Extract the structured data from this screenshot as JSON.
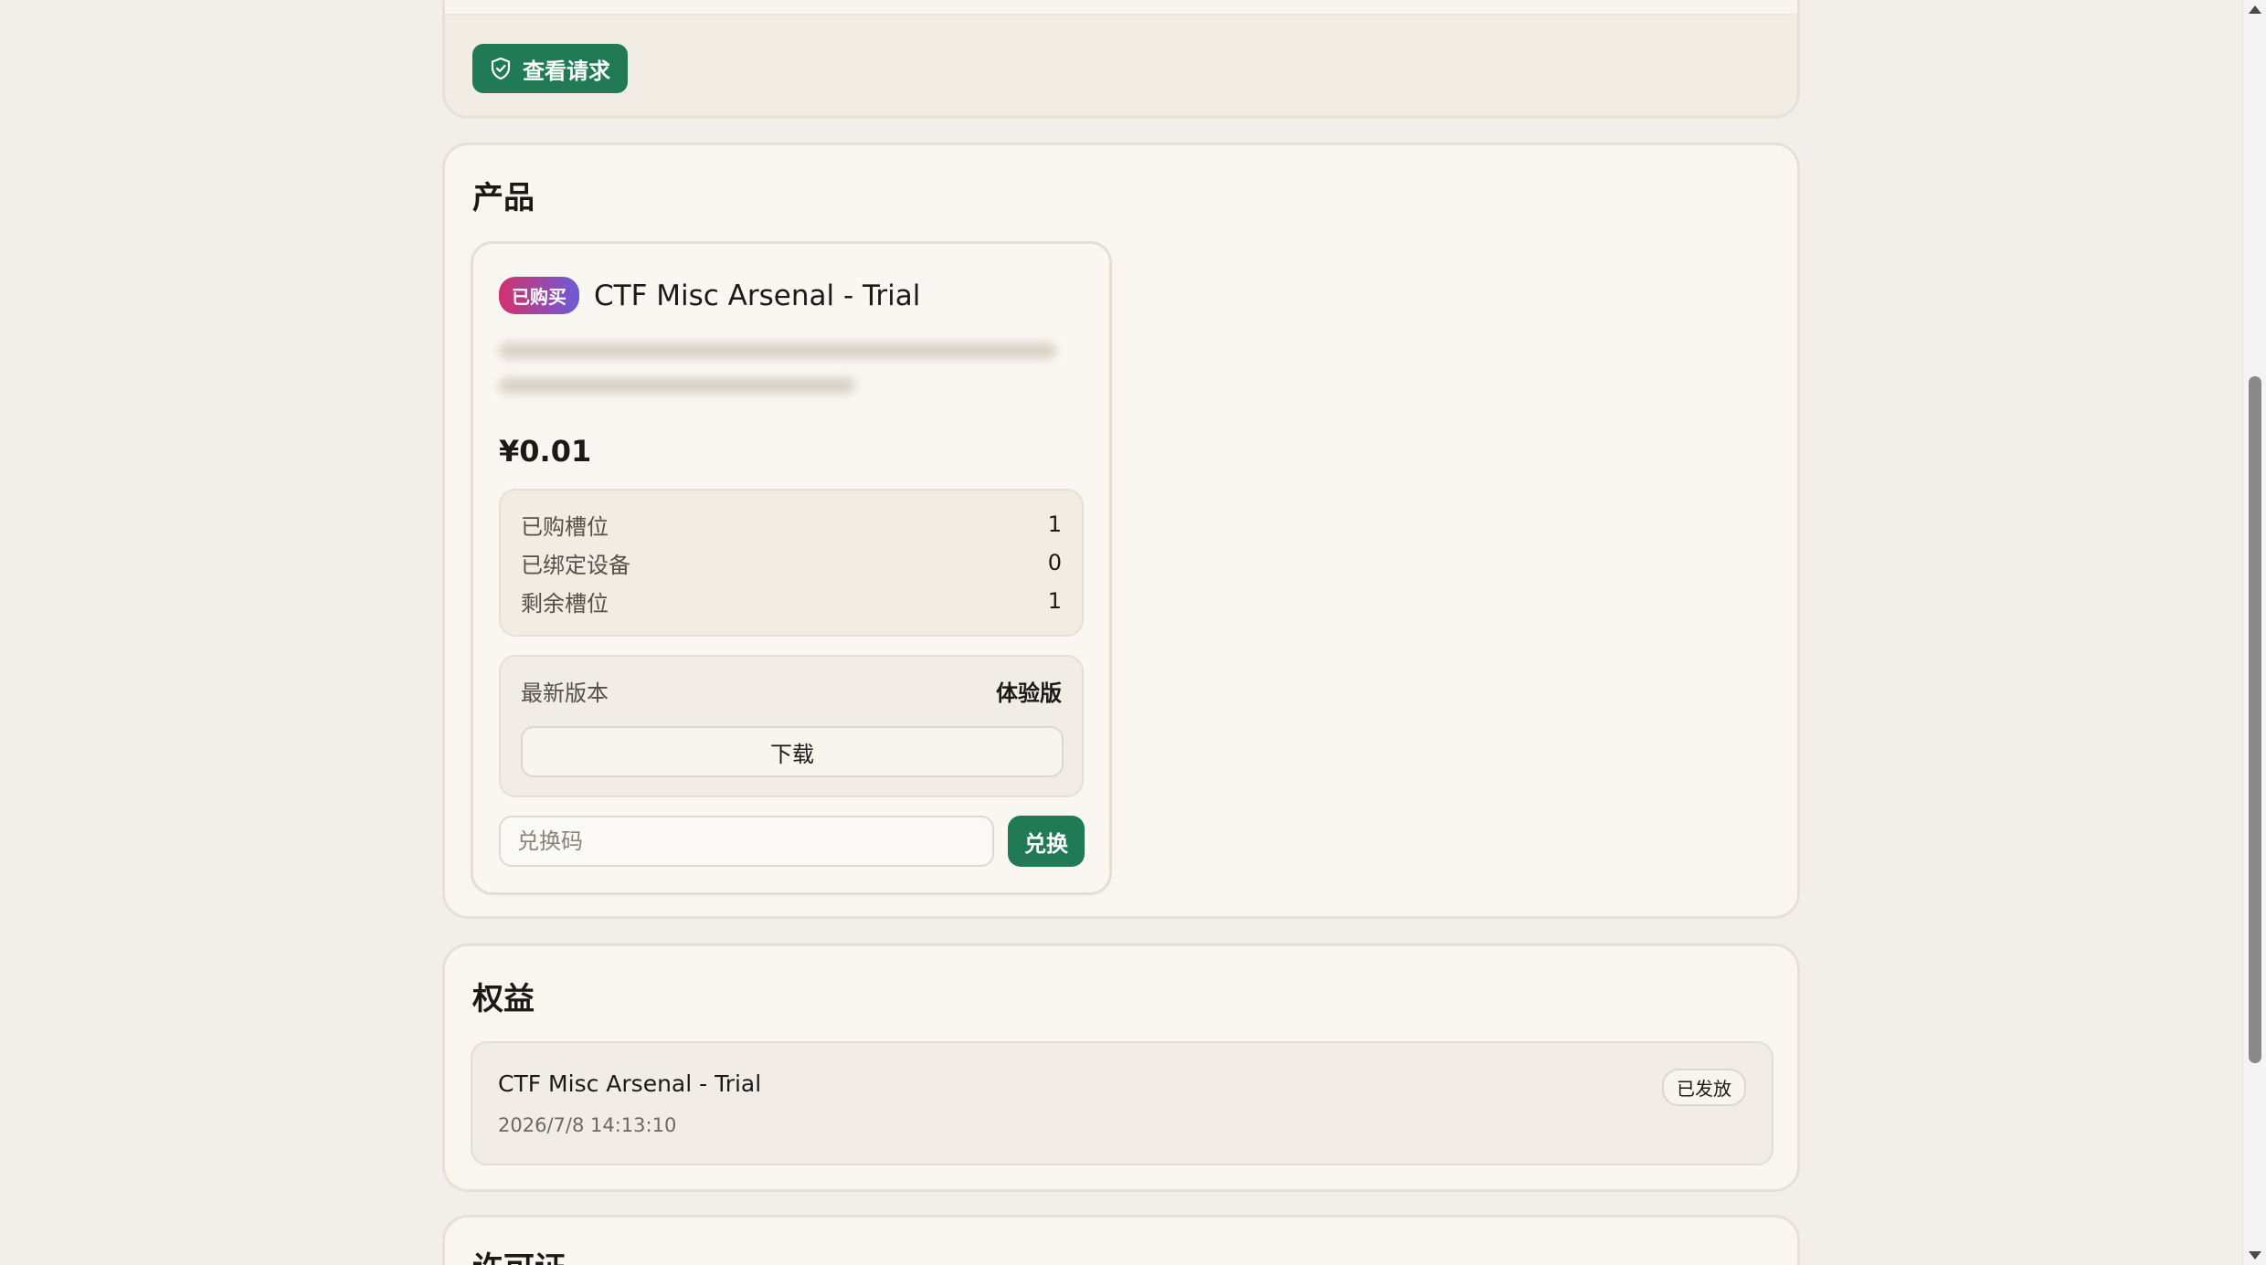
{
  "top_card": {
    "view_request_label": "查看请求"
  },
  "products": {
    "section_title": "产品",
    "item": {
      "badge": "已购买",
      "name": "CTF Misc Arsenal - Trial",
      "price": "¥0.01",
      "stats": [
        {
          "label": "已购槽位",
          "value": "1"
        },
        {
          "label": "已绑定设备",
          "value": "0"
        },
        {
          "label": "剩余槽位",
          "value": "1"
        }
      ],
      "latest_version_label": "最新版本",
      "latest_version_value": "体验版",
      "download_label": "下载",
      "redeem_placeholder": "兑换码",
      "redeem_button": "兑换"
    }
  },
  "rights": {
    "section_title": "权益",
    "item": {
      "name": "CTF Misc Arsenal - Trial",
      "status": "已发放",
      "time": "2026/7/8 14:13:10"
    }
  },
  "license": {
    "section_title": "许可证"
  },
  "colors": {
    "accent_green": "#1f7a55",
    "page_bg": "#f2efea",
    "card_bg": "#f9f6f0"
  }
}
